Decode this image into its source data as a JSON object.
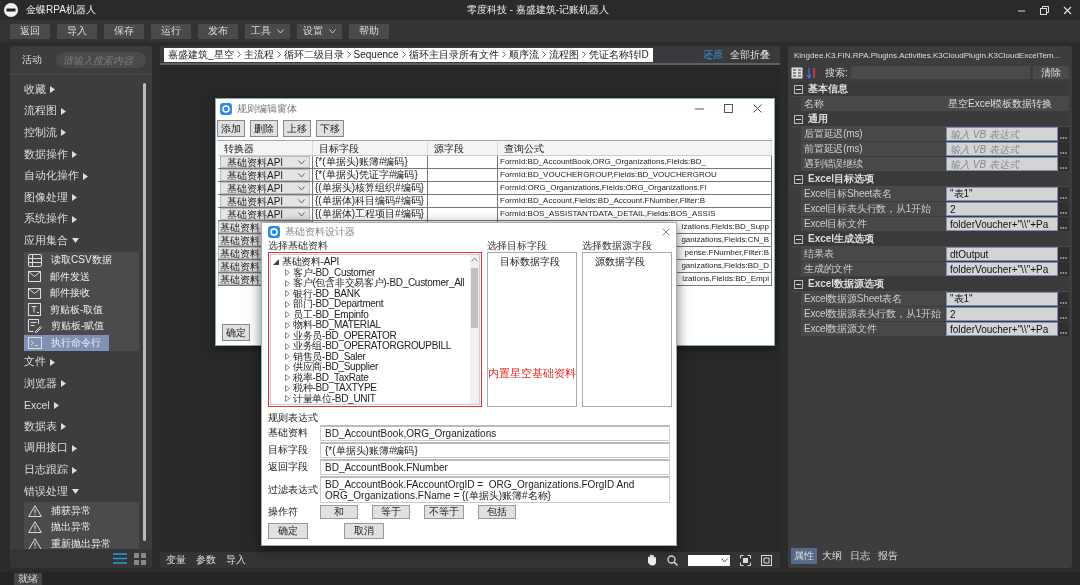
{
  "window": {
    "app_name": "金蝶RPA机器人",
    "title": "零度科技 - 嘉盛建筑-记账机器人"
  },
  "toolbar": [
    {
      "label": "返回",
      "dropdown": false
    },
    {
      "label": "导入",
      "dropdown": false
    },
    {
      "label": "保存",
      "dropdown": false
    },
    {
      "label": "运行",
      "dropdown": false
    },
    {
      "label": "发布",
      "dropdown": false
    },
    {
      "label": "工具",
      "dropdown": true
    },
    {
      "label": "设置",
      "dropdown": true
    },
    {
      "label": "帮助",
      "dropdown": false
    }
  ],
  "activities": {
    "title": "活动",
    "search": {
      "placeholder": "请输入搜索内容"
    },
    "categories": [
      {
        "label": "收藏",
        "expanded": false
      },
      {
        "label": "流程图",
        "expanded": false
      },
      {
        "label": "控制流",
        "expanded": false
      },
      {
        "label": "数据操作",
        "expanded": false
      },
      {
        "label": "自动化操作",
        "expanded": false
      },
      {
        "label": "图像处理",
        "expanded": false
      },
      {
        "label": "系统操作",
        "expanded": false
      },
      {
        "label": "应用集合",
        "expanded": true,
        "children": [
          {
            "label": "读取CSV数据",
            "kind": "table",
            "selected": false
          },
          {
            "label": "邮件发送",
            "kind": "mail",
            "selected": false
          },
          {
            "label": "邮件接收",
            "kind": "mail",
            "selected": false
          },
          {
            "label": "剪贴板-取值",
            "kind": "text",
            "selected": false
          },
          {
            "label": "剪贴板-赋值",
            "kind": "edit",
            "selected": false
          },
          {
            "label": "执行命令行",
            "kind": "terminal",
            "selected": true
          }
        ]
      },
      {
        "label": "文件",
        "expanded": false
      },
      {
        "label": "浏览器",
        "expanded": false
      },
      {
        "label": "Excel",
        "expanded": false
      },
      {
        "label": "数据表",
        "expanded": false
      },
      {
        "label": "调用接口",
        "expanded": false
      },
      {
        "label": "日志跟踪",
        "expanded": false
      },
      {
        "label": "错误处理",
        "expanded": true,
        "children": [
          {
            "label": "捕获异常",
            "kind": "warning",
            "selected": false
          },
          {
            "label": "抛出异常",
            "kind": "warning",
            "selected": false
          },
          {
            "label": "重新抛出异常",
            "kind": "warning",
            "selected": false
          }
        ]
      }
    ],
    "view_modes": [
      {
        "kind": "list",
        "selected": true
      },
      {
        "kind": "grid",
        "selected": false
      }
    ]
  },
  "canvas": {
    "breadcrumb": [
      "嘉盛建筑_星空",
      "主流程",
      "循环二级目录",
      "Sequence",
      "循环主目录所有文件",
      "顺序流",
      "流程图",
      "凭证名称转ID"
    ],
    "links": [
      {
        "label": "还原",
        "kind": "accent"
      },
      {
        "label": "全部折叠",
        "kind": "plain"
      }
    ],
    "bottom_tabs": [
      "变量",
      "参数",
      "导入"
    ]
  },
  "rule_editor": {
    "title": "规则编辑窗体",
    "buttons": [
      "添加",
      "删除",
      "上移",
      "下移"
    ],
    "columns": [
      "转换器",
      "目标字段",
      "源字段",
      "查询公式"
    ],
    "rows": [
      {
        "converter": "基础资料API",
        "target": "{*(单据头)账簿#编码}",
        "formula": "FormId:BD_AccountBook,ORG_Organizations,Fields:BD_"
      },
      {
        "converter": "基础资料API",
        "target": "{*(单据头)凭证字#编码}",
        "formula": "FormId:BD_VOUCHERGROUP,Fields:BD_VOUCHERGROU"
      },
      {
        "converter": "基础资料API",
        "target": "{(单据头)核算组织#编码}",
        "formula": "FormId:ORG_Organizations,Fields:ORG_Organizations.Fl"
      },
      {
        "converter": "基础资料API",
        "target": "{(单据体)科目编码#编码}",
        "formula": "FormId:BD_Account,Fields:BD_Account.FNumber,Filter:B"
      },
      {
        "converter": "基础资料API",
        "target": "{(单据体)工程项目#编码}",
        "formula": "FormId:BOS_ASSISTANTDATA_DETAIL,Fields:BOS_ASSIS"
      },
      {
        "converter": "基础资料",
        "formula": "izations,Fields:BD_Supp"
      },
      {
        "converter": "基础资料",
        "formula": "ganizations,Fields:CN_B"
      },
      {
        "converter": "基础资料",
        "formula": "pense.FNumber,Filter:B"
      },
      {
        "converter": "基础资料",
        "formula": "ganizations,Fields:BD_D"
      },
      {
        "converter": "基础资料",
        "formula": "izations,Fields:BD_Empi"
      }
    ],
    "footer_button": "确定"
  },
  "base_data_designer": {
    "title": "基础资料设计器",
    "source_group": {
      "label": "选择基础资料",
      "tree": [
        {
          "label": "基础资料-API",
          "expanded": true,
          "children": [
            {
              "label": "客户-BD_Customer",
              "expanded": false
            },
            {
              "label": "客户(包含非交易客户)-BD_Customer_All",
              "expanded": false
            },
            {
              "label": "银行-BD_BANK",
              "expanded": false
            },
            {
              "label": "部门-BD_Department",
              "expanded": false
            },
            {
              "label": "员工-BD_Empinfo",
              "expanded": false
            },
            {
              "label": "物料-BD_MATERIAL",
              "expanded": false
            },
            {
              "label": "业务员-BD_OPERATOR",
              "expanded": false
            },
            {
              "label": "业务组-BD_OPERATORGROUPBILL",
              "expanded": false
            },
            {
              "label": "销售员-BD_Saler",
              "expanded": false
            },
            {
              "label": "供应商-BD_Supplier",
              "expanded": false
            },
            {
              "label": "税率-BD_TaxRate",
              "expanded": false
            },
            {
              "label": "税种-BD_TAXTYPE",
              "expanded": false
            },
            {
              "label": "计量单位-BD_UNIT",
              "expanded": false
            }
          ]
        }
      ]
    },
    "target_group": {
      "label": "选择目标字段",
      "items": [
        "目标数据字段"
      ]
    },
    "source_field_group": {
      "label": "选择数据源字段",
      "items": [
        "源数据字段"
      ]
    },
    "annotation": "内置星空基础资料",
    "expression": {
      "label": "规则表达式",
      "fields": [
        {
          "label": "基础资料",
          "value": "BD_AccountBook,ORG_Organizations"
        },
        {
          "label": "目标字段",
          "value": "{*(单据头)账簿#编码}"
        },
        {
          "label": "返回字段",
          "value": "BD_AccountBook.FNumber"
        },
        {
          "label": "过滤表达式",
          "value": "BD_AccountBook.FAccountOrgID =  ORG_Organizations.FOrgID And ORG_Organizations.FName = {(单据头)账簿#名称}"
        }
      ],
      "operators_label": "操作符",
      "operators": [
        "和",
        "等于",
        "不等于",
        "包括"
      ]
    },
    "buttons": [
      "确定",
      "取消"
    ]
  },
  "properties": {
    "title": "Kingdee.K3.FIN.RPA.Plugins.Activities.K3CloudPlugin.K3CloudExcelTem...",
    "search_label": "搜索:",
    "clear_button": "清除",
    "sections": [
      {
        "title": "基本信息",
        "expanded": true,
        "rows": [
          {
            "label": "名称",
            "kind": "text",
            "value": "星空Excel模板数据转换"
          }
        ]
      },
      {
        "title": "通用",
        "expanded": true,
        "rows": [
          {
            "label": "后置延迟(ms)",
            "kind": "expression",
            "placeholder": "输入 VB 表达式"
          },
          {
            "label": "前置延迟(ms)",
            "kind": "expression",
            "placeholder": "输入 VB 表达式"
          },
          {
            "label": "遇到错误继续",
            "kind": "expression",
            "placeholder": "输入 VB 表达式"
          }
        ]
      },
      {
        "title": "Excel目标选项",
        "expanded": true,
        "rows": [
          {
            "label": "Excel目标Sheet表名",
            "kind": "expression",
            "value": "\"表1\""
          },
          {
            "label": "Excel目标表头行数，从1开始",
            "kind": "expression",
            "value": "2"
          },
          {
            "label": "Excel目标文件",
            "kind": "expression",
            "value": "folderVoucher+\"\\\\\"+Pa"
          }
        ]
      },
      {
        "title": "Excel生成选项",
        "expanded": true,
        "rows": [
          {
            "label": "结果表",
            "kind": "expression",
            "value": "dtOutput"
          },
          {
            "label": "生成的文件",
            "kind": "expression",
            "value": "folderVoucher+\"\\\\\"+Pa"
          }
        ]
      },
      {
        "title": "Excel数据源选项",
        "expanded": true,
        "rows": [
          {
            "label": "Excel数据源Sheet表名",
            "kind": "expression",
            "value": "\"表1\""
          },
          {
            "label": "Excel数据源表头行数，从1开始",
            "kind": "expression",
            "value": "2"
          },
          {
            "label": "Excel数据源文件",
            "kind": "expression",
            "value": "folderVoucher+\"\\\\\"+Pa"
          }
        ]
      }
    ]
  },
  "panel_tabs": [
    {
      "label": "属性",
      "selected": true
    },
    {
      "label": "大纲",
      "selected": false
    },
    {
      "label": "日志",
      "selected": false
    },
    {
      "label": "报告",
      "selected": false
    }
  ],
  "status_bar": "就绪"
}
